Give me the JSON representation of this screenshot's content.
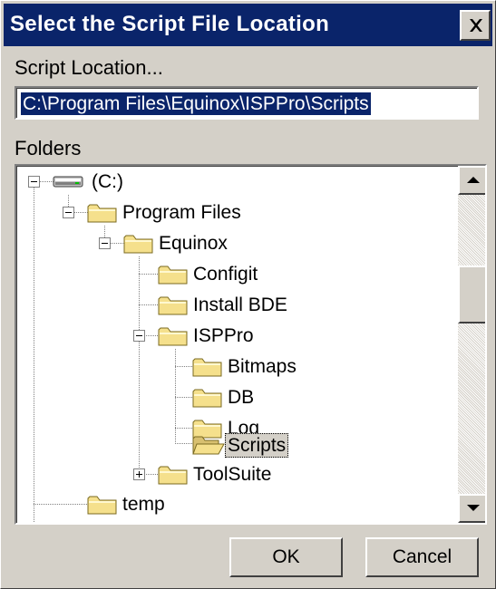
{
  "dialog": {
    "title": "Select the Script File Location",
    "script_location_label": "Script Location...",
    "path_value": "C:\\Program Files\\Equinox\\ISPPro\\Scripts",
    "folders_label": "Folders",
    "ok_label": "OK",
    "cancel_label": "Cancel"
  },
  "tree": {
    "nodes": [
      {
        "label": "(C:)",
        "icon": "drive-icon",
        "state": "expanded"
      },
      {
        "label": "Program Files",
        "icon": "folder-icon",
        "state": "expanded"
      },
      {
        "label": "Equinox",
        "icon": "folder-icon",
        "state": "expanded"
      },
      {
        "label": "Configit",
        "icon": "folder-icon",
        "state": "leaf"
      },
      {
        "label": "Install BDE",
        "icon": "folder-icon",
        "state": "leaf"
      },
      {
        "label": "ISPPro",
        "icon": "folder-icon",
        "state": "expanded"
      },
      {
        "label": "Bitmaps",
        "icon": "folder-icon",
        "state": "leaf"
      },
      {
        "label": "DB",
        "icon": "folder-icon",
        "state": "leaf"
      },
      {
        "label": "Log",
        "icon": "folder-icon",
        "state": "leaf"
      },
      {
        "label": "Scripts",
        "icon": "open-folder-icon",
        "state": "leaf",
        "selected": true
      },
      {
        "label": "ToolSuite",
        "icon": "folder-icon",
        "state": "collapsed"
      },
      {
        "label": "temp",
        "icon": "folder-icon",
        "state": "leaf"
      }
    ]
  },
  "colors": {
    "title_bar": "#0a246a",
    "face": "#d4d0c8",
    "selection": "#0a246a",
    "folder": "#f5e08c"
  }
}
